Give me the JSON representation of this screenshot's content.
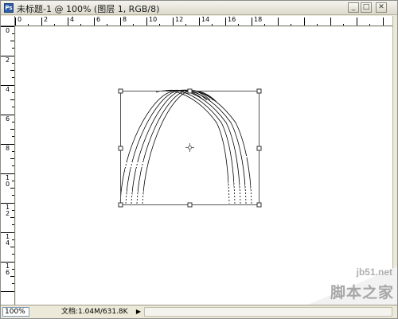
{
  "window": {
    "title": "未标题-1 @ 100% (图层 1, RGB/8)",
    "minimize_glyph": "_",
    "maximize_glyph": "□",
    "close_glyph": "✕"
  },
  "rulers": {
    "top_labels": [
      "0",
      "2",
      "4",
      "6",
      "8",
      "10",
      "12",
      "14",
      "16",
      "18"
    ],
    "left_labels": [
      "0",
      "2",
      "4",
      "6",
      "8",
      "1\n0",
      "1\n2",
      "1\n4",
      "1\n6"
    ]
  },
  "status": {
    "zoom": "100%",
    "doc_info": "文档:1.04M/631.8K",
    "menu_arrow": "▶"
  },
  "watermark": {
    "url": "jb51.net",
    "name": "脚本之家"
  },
  "colors": {
    "chrome": "#ece9d8",
    "canvas": "#ffffff",
    "stroke": "#000000",
    "bbox": "#333333"
  },
  "icons": {
    "app": "photoshop-app-icon",
    "center_point": "transform-center-crosshair-icon"
  }
}
